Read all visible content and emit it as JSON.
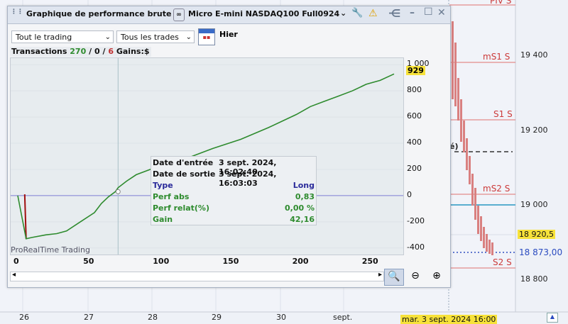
{
  "window": {
    "title": "Graphique de performance brute",
    "instrument": "Micro E-mini NASDAQ100 Full0924",
    "scope_select": "Tout le trading",
    "trades_select": "Tous les trades",
    "calendar_label": "Hier",
    "info": {
      "label": "Transactions",
      "count": "270",
      "sep1": "/",
      "mid": "0",
      "sep2": "/",
      "losses": "6",
      "gains": "Gains:$"
    },
    "watermark": "ProRealTime Trading",
    "yaxis": {
      "ticks": [
        "1 000",
        "800",
        "600",
        "400",
        "200",
        "0",
        "-200",
        "-400"
      ],
      "last_value": "929"
    },
    "xaxis": {
      "ticks": [
        "0",
        "50",
        "100",
        "150",
        "200",
        "250"
      ]
    },
    "tooltip": {
      "entry_label": "Date d'entrée",
      "entry_value": "3 sept. 2024, 16:02:40",
      "exit_label": "Date de sortie",
      "exit_value": "3 sept. 2024, 16:03:03",
      "type_label": "Type",
      "type_value": "Long",
      "perf_abs_label": "Perf abs",
      "perf_abs_value": "0,83",
      "perf_rel_label": "Perf relat(%)",
      "perf_rel_value": "0,00 %",
      "gain_label": "Gain",
      "gain_value": "42,16"
    },
    "icons": [
      "wrench-icon",
      "warning-icon",
      "share-icon",
      "minimize-icon",
      "maximize-icon",
      "close-icon",
      "zoom-fit-icon",
      "zoom-out-icon",
      "zoom-in-icon"
    ]
  },
  "main_chart": {
    "levels": [
      "PIV S",
      "mS1 S",
      "S1 S",
      "mS2 S",
      "S2 S"
    ],
    "paren_label": "é)",
    "price_ticks": [
      "19 400",
      "19 200",
      "19 000",
      "18 800"
    ],
    "price_tag_1": "18 920,5",
    "price_tag_2": "18 873,00",
    "dates": [
      "26",
      "27",
      "28",
      "29",
      "30",
      "sept."
    ],
    "crosshair_date": "mar. 3 sept. 2024 16:00"
  },
  "colors": {
    "equity": "#2e8b2e",
    "drawdown": "#a01010",
    "zero_line": "#7f7fd6",
    "level": "#cc3a3a"
  },
  "chart_data": {
    "type": "line",
    "x_ticks": [
      0,
      50,
      100,
      150,
      200,
      250
    ],
    "y_ticks": [
      -400,
      -200,
      0,
      200,
      400,
      600,
      800,
      1000
    ],
    "xlim": [
      0,
      270
    ],
    "ylim": [
      -450,
      1050
    ],
    "x": [
      0,
      5,
      6,
      10,
      20,
      28,
      35,
      45,
      55,
      60,
      65,
      70,
      72,
      78,
      85,
      95,
      110,
      125,
      140,
      160,
      180,
      200,
      210,
      220,
      230,
      240,
      250,
      260,
      270
    ],
    "y": [
      0,
      10,
      -330,
      -320,
      -300,
      -290,
      -270,
      -200,
      -130,
      -60,
      -10,
      30,
      60,
      110,
      160,
      200,
      250,
      300,
      360,
      430,
      520,
      620,
      680,
      720,
      760,
      800,
      850,
      880,
      929
    ],
    "last_value": 929
  }
}
